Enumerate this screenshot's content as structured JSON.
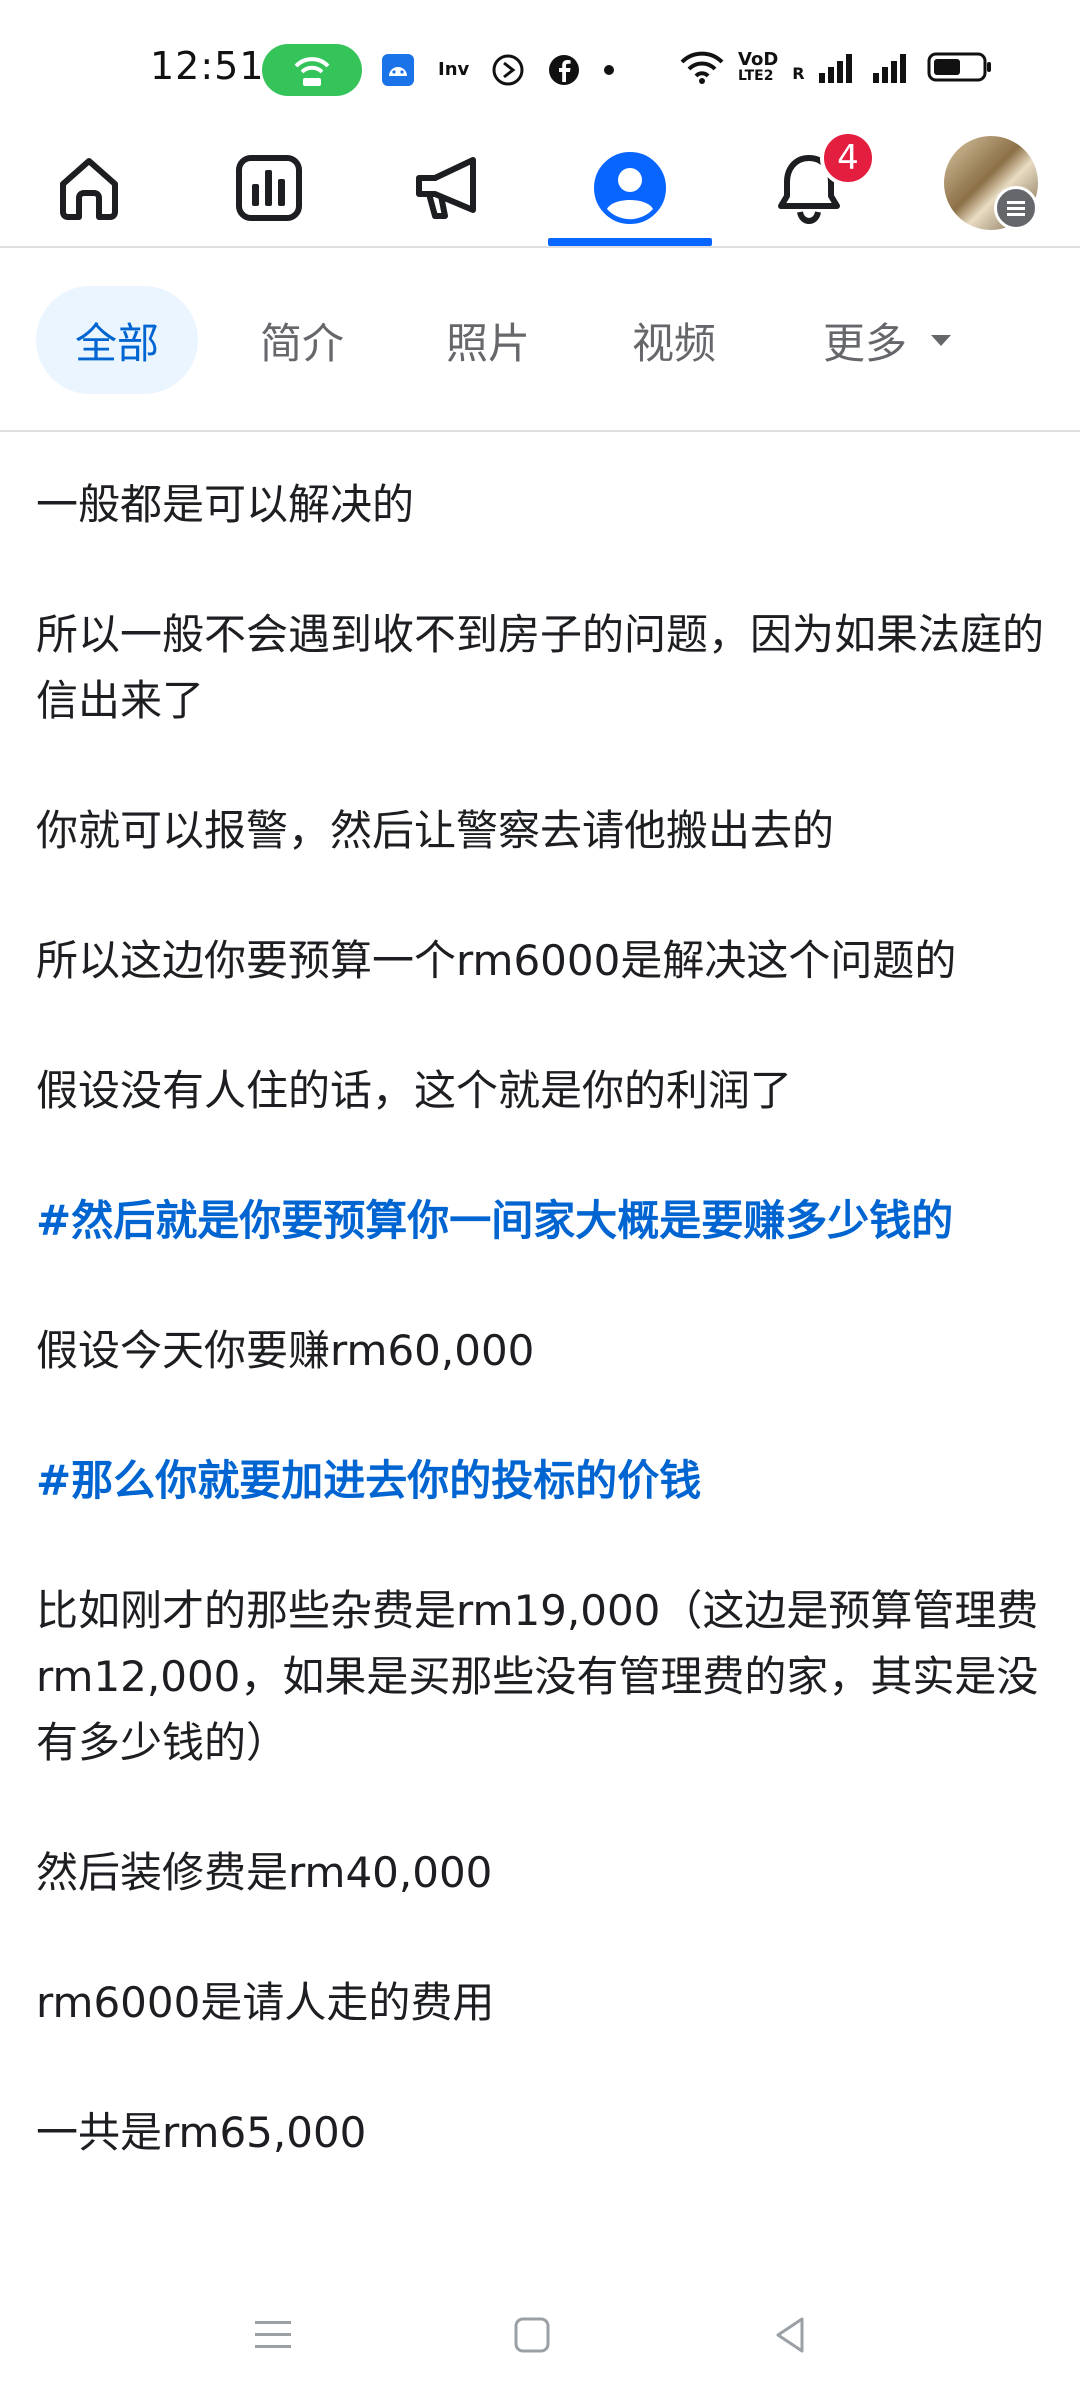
{
  "status_bar": {
    "time": "12:51",
    "icons": [
      "hotspot-icon",
      "android-icon",
      "inv-icon",
      "media-icon",
      "facebook-icon",
      "dot-icon",
      "wifi-icon",
      "volte-icon",
      "signal-icon",
      "signal-icon",
      "battery-icon"
    ],
    "inv_text": "Inv",
    "volte_top": "VoD",
    "volte_bottom": "LTE2",
    "r_label": "R"
  },
  "top_nav": {
    "items": [
      "home-icon",
      "dashboard-icon",
      "megaphone-icon",
      "profile-icon",
      "bell-icon",
      "avatar"
    ],
    "active": "profile-icon",
    "notification_count": "4",
    "accent": "#0866ff"
  },
  "filter_tabs": [
    {
      "label": "全部",
      "active": true
    },
    {
      "label": "简介",
      "active": false
    },
    {
      "label": "照片",
      "active": false
    },
    {
      "label": "视频",
      "active": false
    },
    {
      "label": "更多",
      "active": false,
      "has_dropdown": true
    }
  ],
  "post": {
    "paragraphs": [
      {
        "text": "一般都是可以解决的",
        "hashtag": false
      },
      {
        "text": "所以一般不会遇到收不到房子的问题，因为如果法庭的信出来了",
        "hashtag": false
      },
      {
        "text": "你就可以报警，然后让警察去请他搬出去的",
        "hashtag": false
      },
      {
        "text": "所以这边你要预算一个rm6000是解决这个问题的",
        "hashtag": false
      },
      {
        "text": "假设没有人住的话，这个就是你的利润了",
        "hashtag": false
      },
      {
        "text": "#然后就是你要预算你一间家大概是要赚多少钱的",
        "hashtag": true
      },
      {
        "text": "假设今天你要赚rm60,000",
        "hashtag": false
      },
      {
        "text": "#那么你就要加进去你的投标的价钱",
        "hashtag": true
      },
      {
        "text": "比如刚才的那些杂费是rm19,000（这边是预算管理费rm12,000，如果是买那些没有管理费的家，其实是没有多少钱的）",
        "hashtag": false
      },
      {
        "text": "然后装修费是rm40,000",
        "hashtag": false
      },
      {
        "text": "rm6000是请人走的费用",
        "hashtag": false
      },
      {
        "text": "一共是rm65,000",
        "hashtag": false
      }
    ],
    "hashtag_color": "#0064d1"
  },
  "system_nav": [
    "menu-icon",
    "home-square-icon",
    "back-icon"
  ]
}
